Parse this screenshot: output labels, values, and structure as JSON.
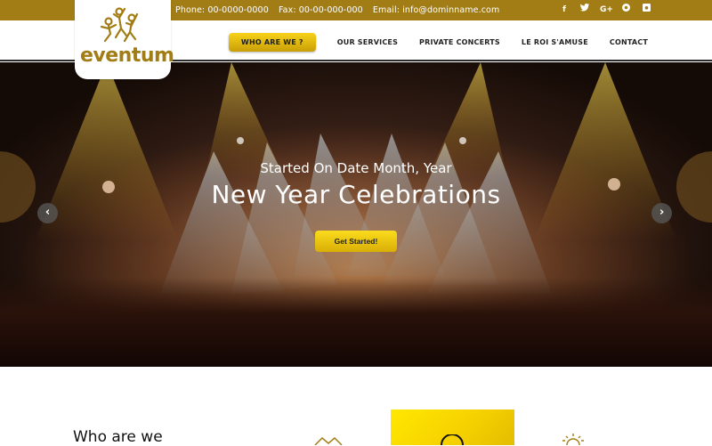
{
  "topbar": {
    "phone": "Phone: 00-0000-0000",
    "fax": "Fax: 00-00-000-000",
    "email": "Email: info@dominname.com",
    "social": [
      {
        "icon": "facebook-icon",
        "glyph": "f"
      },
      {
        "icon": "twitter-icon",
        "glyph": "t"
      },
      {
        "icon": "google-plus-icon",
        "glyph": "G+"
      },
      {
        "icon": "pinterest-icon",
        "glyph": "P"
      },
      {
        "icon": "instagram-icon",
        "glyph": "◙"
      }
    ],
    "color": "#a27d15"
  },
  "logo": {
    "text": "eventum"
  },
  "nav": {
    "items": [
      {
        "label": "WHO ARE WE ?",
        "active": true
      },
      {
        "label": "OUR SERVICES"
      },
      {
        "label": "PRIVATE CONCERTS"
      },
      {
        "label": "LE ROI S'AMUSE"
      },
      {
        "label": "CONTACT"
      }
    ]
  },
  "hero": {
    "subtitle": "Started On Date Month, Year",
    "title": "New Year Celebrations",
    "cta": "Get Started!",
    "prev": "‹",
    "next": "›"
  },
  "section": {
    "heading": "Who are we"
  }
}
